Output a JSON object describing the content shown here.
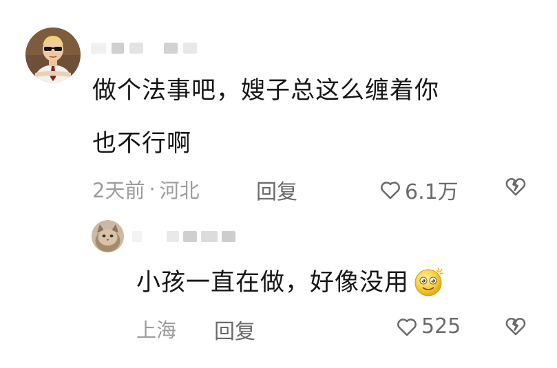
{
  "comments": [
    {
      "text_line1": "做个法事吧，嫂子总这么缠着你",
      "text_line2": "也不行啊",
      "time": "2天前",
      "separator": "·",
      "location": "河北",
      "reply_label": "回复",
      "likes": "6.1万",
      "avatar_icon": "cartoon-man-sunglasses-avatar"
    },
    {
      "text": "小孩一直在做，好像没用",
      "emoji": "dizzy-smiley-emoji",
      "location": "上海",
      "reply_label": "回复",
      "likes": "525",
      "avatar_icon": "cat-avatar"
    }
  ],
  "icons": {
    "like": "heart-outline-icon",
    "dislike": "broken-heart-icon"
  },
  "colors": {
    "text": "#161616",
    "meta": "#9c9c9c",
    "action": "#6a6a6a"
  }
}
